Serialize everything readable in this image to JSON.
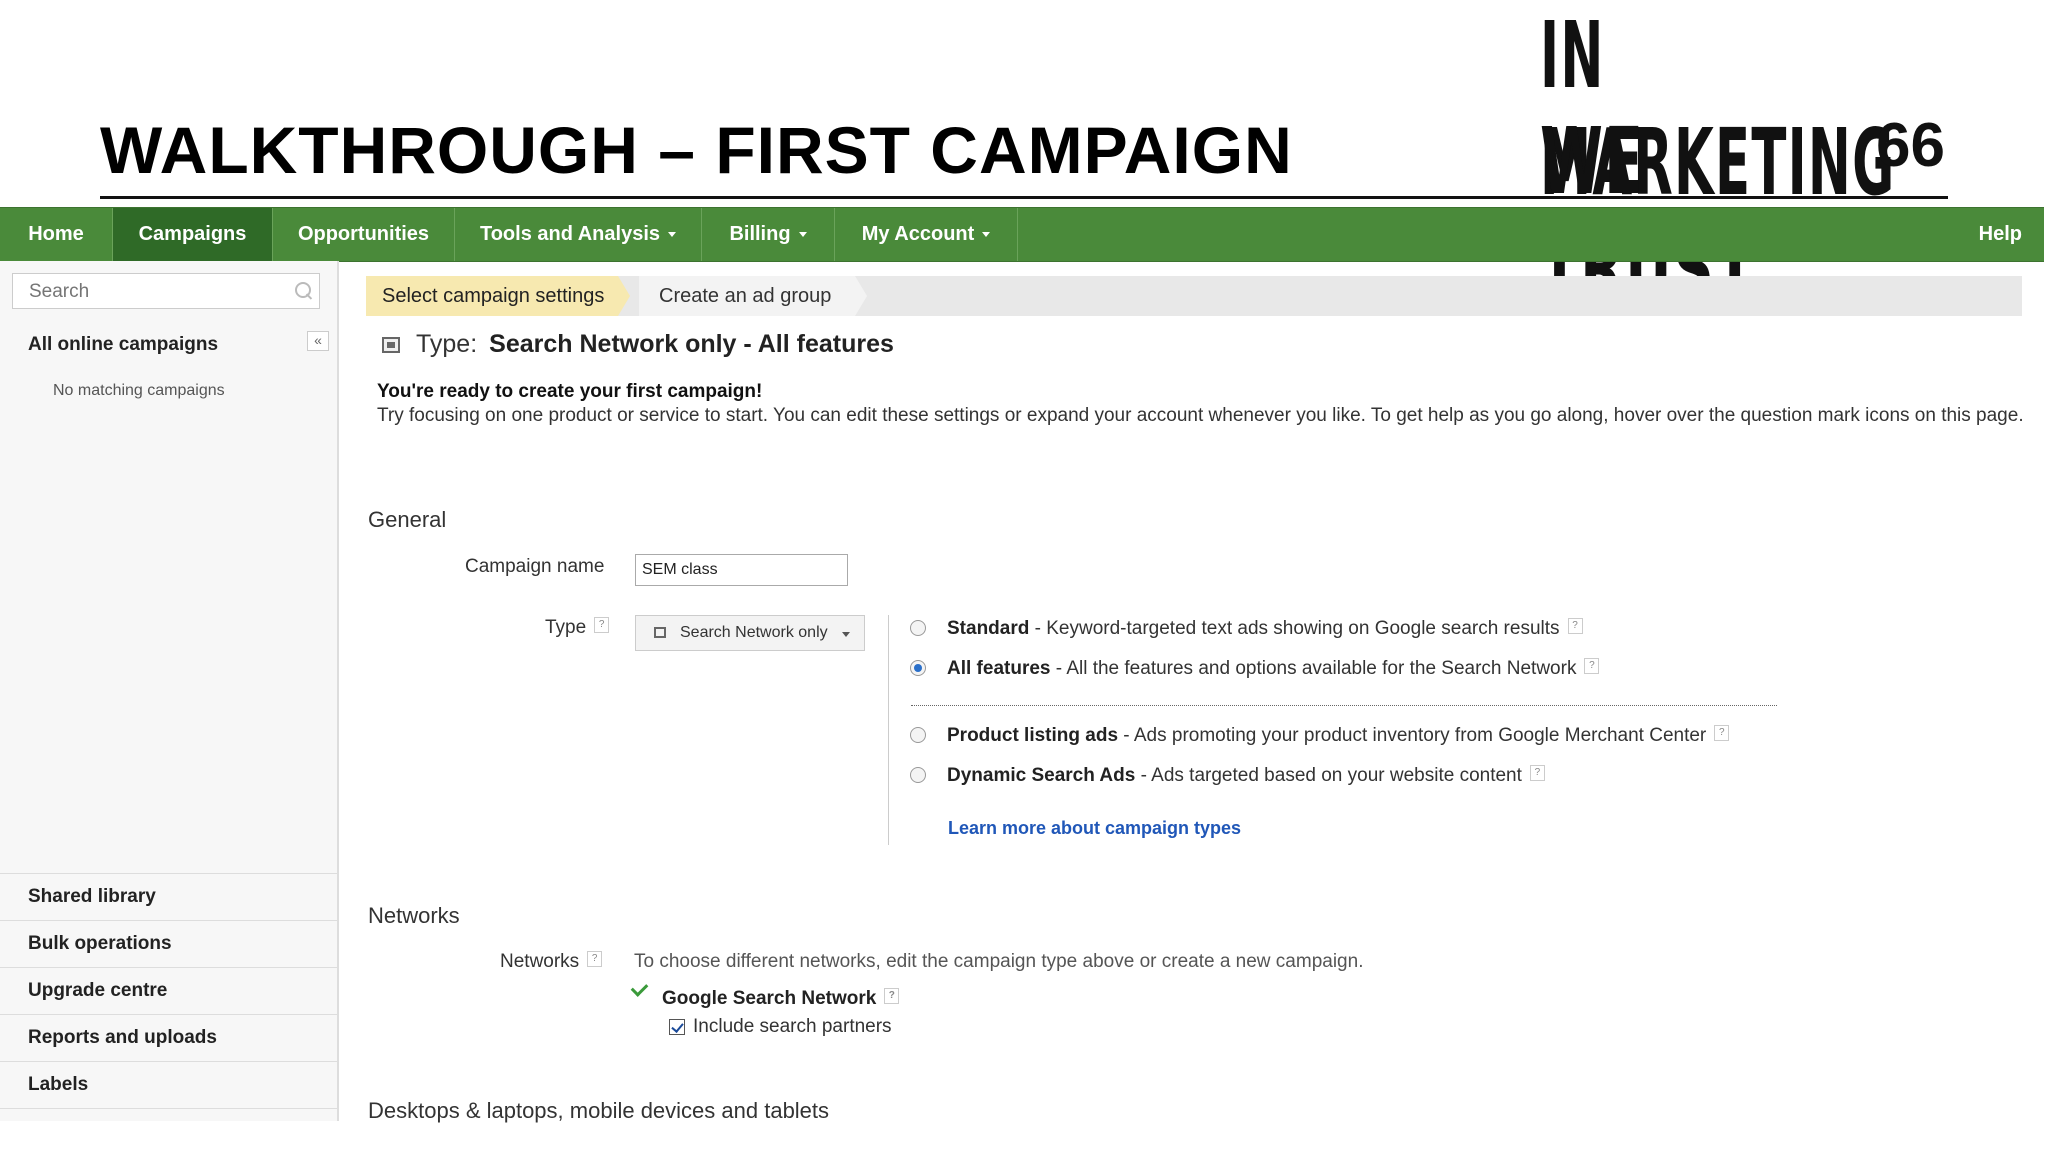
{
  "slide": {
    "title": "WALKTHROUGH – FIRST CAMPAIGN",
    "brand_line1": "IN MARKETING",
    "brand_line2": "WE TRUST",
    "page_number": "66"
  },
  "nav": {
    "items": [
      {
        "label": "Home"
      },
      {
        "label": "Campaigns"
      },
      {
        "label": "Opportunities"
      },
      {
        "label": "Tools and Analysis"
      },
      {
        "label": "Billing"
      },
      {
        "label": "My Account"
      }
    ],
    "help": "Help",
    "active": "Campaigns"
  },
  "sidebar": {
    "search_placeholder": "Search",
    "all_online": "All online campaigns",
    "collapse_glyph": "«",
    "no_match": "No matching campaigns",
    "links": [
      "Shared library",
      "Bulk operations",
      "Upgrade centre",
      "Reports and uploads",
      "Labels"
    ]
  },
  "breadcrumb": {
    "step1": "Select campaign settings",
    "step2": "Create an ad group"
  },
  "main": {
    "type_label": "Type:",
    "type_value": "Search Network only - All features",
    "ready_title": "You're ready to create your first campaign!",
    "ready_body": "Try focusing on one product or service to start. You can edit these settings or expand your account whenever you like. To get help as you go along, hover over the question mark icons on this page.",
    "general": {
      "heading": "General",
      "campaign_name_label": "Campaign name",
      "campaign_name_value": "SEM class",
      "type_label": "Type",
      "type_dropdown": "Search Network only",
      "options": [
        {
          "name": "Standard",
          "desc": " - Keyword-targeted text ads showing on Google search results",
          "selected": false
        },
        {
          "name": "All features",
          "desc": " - All the features and options available for the Search Network",
          "selected": true
        },
        {
          "name": "Product listing ads",
          "desc": " - Ads promoting your product inventory from Google Merchant Center",
          "selected": false
        },
        {
          "name": "Dynamic Search Ads",
          "desc": " - Ads targeted based on your website content",
          "selected": false
        }
      ],
      "learn_more": "Learn more about campaign types"
    },
    "networks": {
      "heading": "Networks",
      "label": "Networks",
      "desc": "To choose different networks, edit the campaign type above or create a new campaign.",
      "google_search": "Google Search Network",
      "include_partners": "Include search partners",
      "partners_checked": true
    },
    "devices_heading": "Desktops & laptops, mobile devices and tablets"
  },
  "colors": {
    "nav_green": "#4a8a3a",
    "nav_active": "#2f6a27",
    "breadcrumb_active": "#f7e9b0",
    "link_blue": "#2057b8"
  }
}
